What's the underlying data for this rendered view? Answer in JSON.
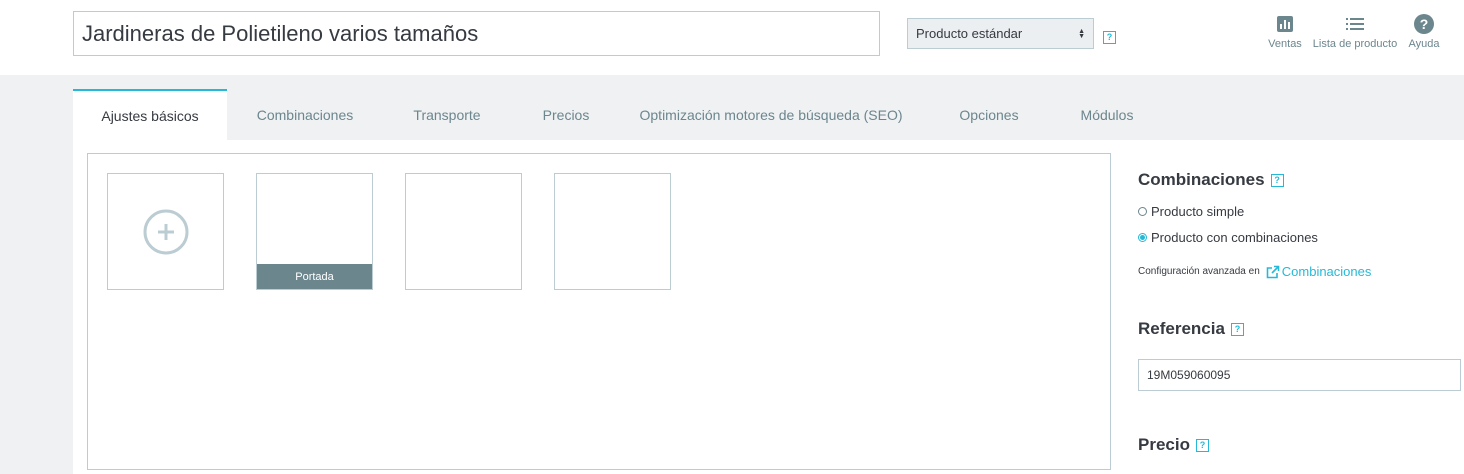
{
  "header": {
    "product_name": "Jardineras de Polietileno varios tamaños",
    "product_type": "Producto estándar",
    "help_mark": "?",
    "actions": [
      {
        "label": "Ventas",
        "icon": "bar-chart-icon"
      },
      {
        "label": "Lista de producto",
        "icon": "list-icon"
      },
      {
        "label": "Ayuda",
        "icon": "help-circle-icon"
      }
    ]
  },
  "tabs": [
    {
      "label": "Ajustes básicos",
      "active": true
    },
    {
      "label": "Combinaciones",
      "active": false
    },
    {
      "label": "Transporte",
      "active": false
    },
    {
      "label": "Precios",
      "active": false
    },
    {
      "label": "Optimización motores de búsqueda (SEO)",
      "active": false
    },
    {
      "label": "Opciones",
      "active": false
    },
    {
      "label": "Módulos",
      "active": false
    }
  ],
  "images": {
    "add_icon": "plus-circle-icon",
    "cover_label": "Portada"
  },
  "sidebar": {
    "combinations": {
      "title": "Combinaciones",
      "options": [
        {
          "label": "Producto simple",
          "checked": false
        },
        {
          "label": "Producto con combinaciones",
          "checked": true
        }
      ],
      "advanced_text": "Configuración avanzada en",
      "advanced_link": "Combinaciones"
    },
    "reference": {
      "title": "Referencia",
      "value": "19M059060095"
    },
    "price": {
      "title": "Precio"
    }
  },
  "colors": {
    "accent": "#25b9d7",
    "muted": "#6c868e",
    "border": "#bbcdd2"
  }
}
